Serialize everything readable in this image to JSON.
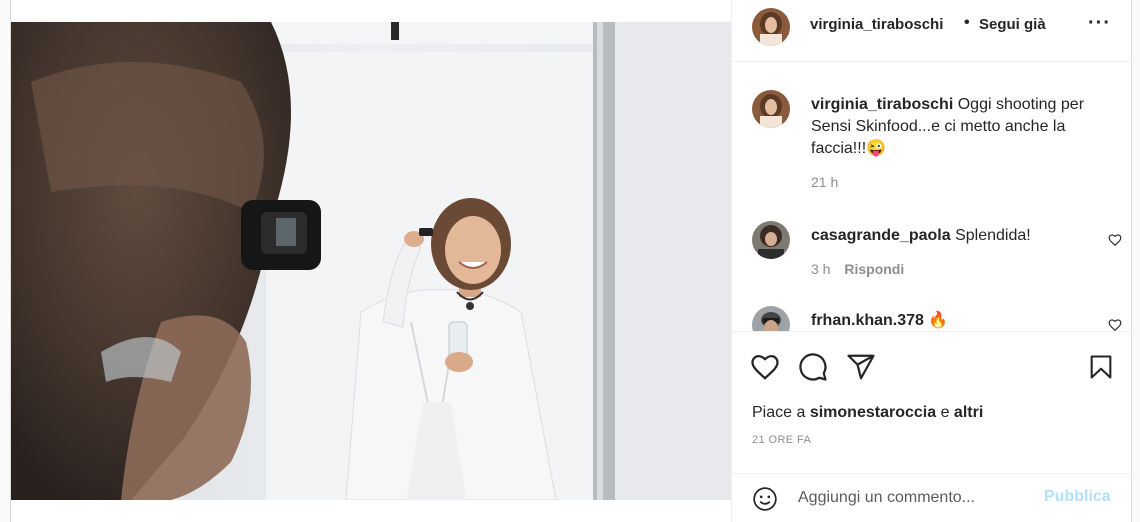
{
  "post": {
    "author": {
      "username": "virginia_tiraboschi",
      "separator": "•",
      "follow_label": "Segui già",
      "more_label": "···"
    },
    "caption": {
      "username": "virginia_tiraboschi",
      "text": "Oggi shooting per Sensi Skinfood...e ci metto anche la faccia!!!",
      "emoji": "😜",
      "time": "21 h"
    },
    "comments": [
      {
        "username": "casagrande_paola",
        "text": "Splendida!",
        "time": "3 h",
        "reply_label": "Rispondi"
      },
      {
        "username": "frhan.khan.378",
        "text": "🔥"
      }
    ],
    "likes": {
      "prefix": "Piace a",
      "user": "simonestaroccia",
      "conj": "e",
      "others": "altri"
    },
    "timestamp": "21 ORE FA",
    "add_comment": {
      "placeholder": "Aggiungi un commento...",
      "publish_label": "Pubblica"
    },
    "icons": {
      "like": "heart-icon",
      "comment": "comment-bubble-icon",
      "share": "paper-plane-icon",
      "save": "bookmark-icon",
      "emoji": "smiley-icon",
      "more": "more-dots-icon"
    },
    "colors": {
      "publish_disabled": "#b2dffc",
      "secondary_text": "#8e8e8e"
    }
  }
}
